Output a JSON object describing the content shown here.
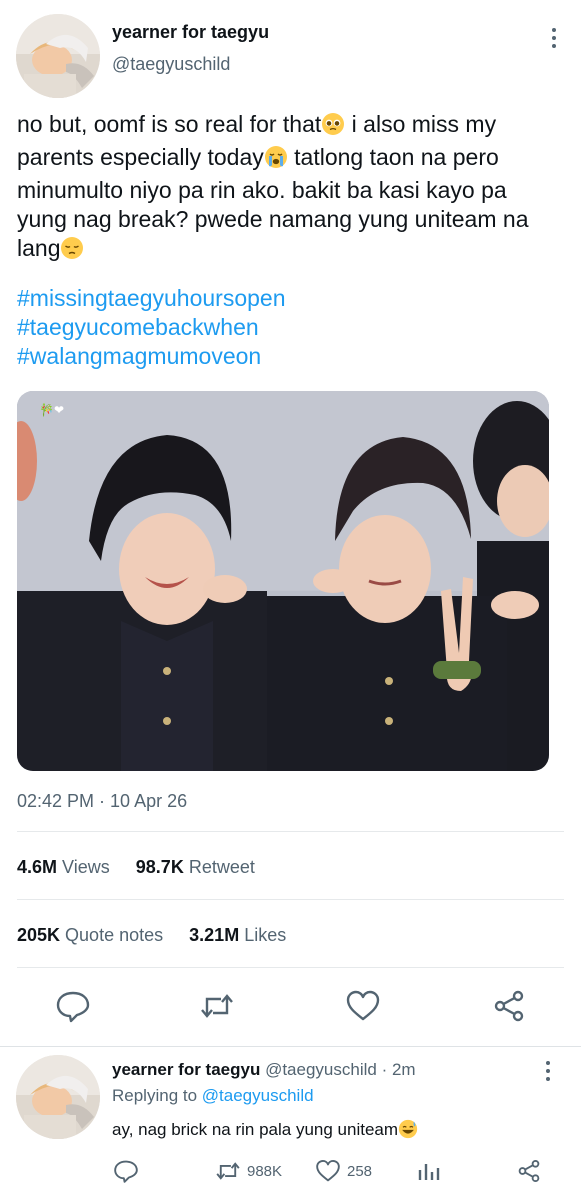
{
  "tweet": {
    "author_name": "yearner for taegyu",
    "author_handle": "@taegyuschild",
    "text_lines": [
      "no but, oomf is so real for that",
      " i also miss my",
      "parents especially today",
      " tatlong taon na pero",
      "minumulto niyo pa rin ako. bakit ba kasi kayo pa",
      "yung nag break? pwede namang yung uniteam na",
      "lang"
    ],
    "hashtags": [
      "#missingtaegyuhoursopen",
      "#taegyucomebackwhen",
      "#walangmagmumoveon"
    ],
    "media_watermark": "🎋❤",
    "timestamp": "02:42 PM · 10 Apr 26"
  },
  "stats": {
    "views_value": "4.6M",
    "views_label": "Views",
    "retweet_value": "98.7K",
    "retweet_label": "Retweet",
    "quote_value": "205K",
    "quote_label": "Quote notes",
    "likes_value": "3.21M",
    "likes_label": "Likes"
  },
  "actions": [
    "reply-icon",
    "retweet-icon",
    "like-icon",
    "share-icon"
  ],
  "reply": {
    "author_name": "yearner for taegyu",
    "author_handle": "@taegyuschild",
    "time": "· 2m",
    "replying_prefix": "Replying to",
    "replying_to": "@taegyuschild",
    "text": "ay, nag brick na rin pala yung uniteam",
    "retweets": "988K",
    "likes": "258"
  },
  "colors": {
    "accent": "#1d9bf0",
    "muted": "#536471",
    "text": "#0f1419"
  }
}
